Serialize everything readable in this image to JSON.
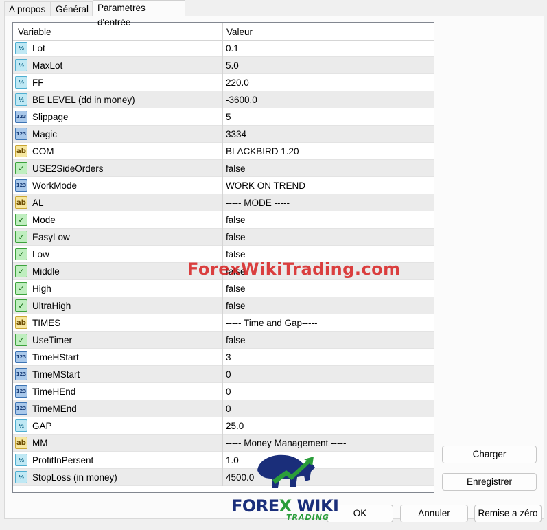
{
  "tabs": [
    "A propos",
    "Général",
    "Parametres d'entrée"
  ],
  "active_tab": "Parametres d'entrée",
  "grid": {
    "columns": [
      "Variable",
      "Valeur"
    ],
    "rows": [
      {
        "icon": "fraction-icon",
        "name": "Lot",
        "value": "0.1"
      },
      {
        "icon": "fraction-icon",
        "name": "MaxLot",
        "value": "5.0"
      },
      {
        "icon": "fraction-icon",
        "name": "FF",
        "value": "220.0"
      },
      {
        "icon": "fraction-icon",
        "name": "BE LEVEL (dd in money)",
        "value": "-3600.0"
      },
      {
        "icon": "integer-icon",
        "name": "Slippage",
        "value": "5"
      },
      {
        "icon": "integer-icon",
        "name": "Magic",
        "value": "3334"
      },
      {
        "icon": "string-icon",
        "name": "COM",
        "value": "BLACKBIRD 1.20"
      },
      {
        "icon": "boolean-icon",
        "name": "USE2SideOrders",
        "value": "false"
      },
      {
        "icon": "integer-icon",
        "name": "WorkMode",
        "value": "WORK ON TREND"
      },
      {
        "icon": "string-icon",
        "name": "AL",
        "value": " ----- MODE -----"
      },
      {
        "icon": "boolean-icon",
        "name": "Mode",
        "value": "false"
      },
      {
        "icon": "boolean-icon",
        "name": "EasyLow",
        "value": "false"
      },
      {
        "icon": "boolean-icon",
        "name": "Low",
        "value": "false"
      },
      {
        "icon": "boolean-icon",
        "name": "Middle",
        "value": "false"
      },
      {
        "icon": "boolean-icon",
        "name": "High",
        "value": "false"
      },
      {
        "icon": "boolean-icon",
        "name": "UltraHigh",
        "value": "false"
      },
      {
        "icon": "string-icon",
        "name": "TIMES",
        "value": " ----- Time and Gap-----"
      },
      {
        "icon": "boolean-icon",
        "name": "UseTimer",
        "value": "false"
      },
      {
        "icon": "integer-icon",
        "name": "TimeHStart",
        "value": "3"
      },
      {
        "icon": "integer-icon",
        "name": "TimeMStart",
        "value": "0"
      },
      {
        "icon": "integer-icon",
        "name": "TimeHEnd",
        "value": "0"
      },
      {
        "icon": "integer-icon",
        "name": "TimeMEnd",
        "value": "0"
      },
      {
        "icon": "fraction-icon",
        "name": "GAP",
        "value": "25.0"
      },
      {
        "icon": "string-icon",
        "name": "MM",
        "value": " ----- Money Management -----"
      },
      {
        "icon": "fraction-icon",
        "name": "ProfitInPersent",
        "value": "1.0"
      },
      {
        "icon": "fraction-icon",
        "name": "StopLoss (in money)",
        "value": "4500.0"
      }
    ]
  },
  "buttons": {
    "load": "Charger",
    "save": "Enregistrer",
    "ok": "OK",
    "cancel": "Annuler",
    "reset": "Remise a zéro"
  },
  "watermark": "ForexWikiTrading.com",
  "logo": {
    "line1_a": "FORE",
    "line1_x": "X",
    "line1_b": " WIKI",
    "line2": "TRADING"
  },
  "icon_glyphs": {
    "fraction-icon": "½",
    "integer-icon": "123",
    "string-icon": "ab",
    "boolean-icon": "✓"
  }
}
